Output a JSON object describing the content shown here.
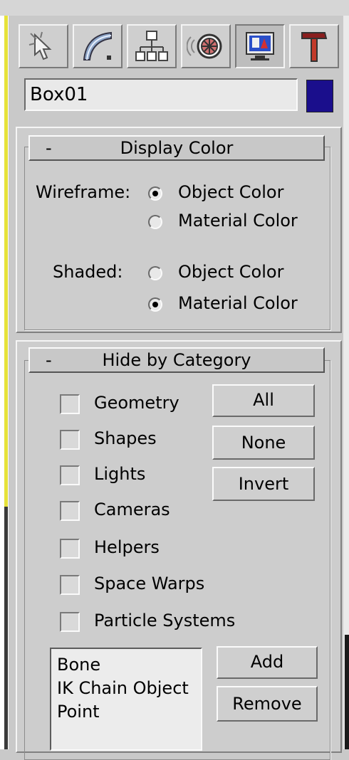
{
  "toolbar": {
    "tabs": [
      {
        "icon": "cursor-arrow-icon",
        "active": false
      },
      {
        "icon": "curve-modify-icon",
        "active": false
      },
      {
        "icon": "hierarchy-icon",
        "active": false
      },
      {
        "icon": "motion-wheel-icon",
        "active": false
      },
      {
        "icon": "display-monitor-icon",
        "active": true
      },
      {
        "icon": "hammer-utilities-icon",
        "active": false
      }
    ]
  },
  "object": {
    "name": "Box01",
    "color": "#1a0e8c"
  },
  "display_color": {
    "collapse_glyph": "-",
    "title": "Display Color",
    "wireframe": {
      "label": "Wireframe:",
      "options": [
        "Object Color",
        "Material Color"
      ],
      "selected": "Object Color"
    },
    "shaded": {
      "label": "Shaded:",
      "options": [
        "Object Color",
        "Material Color"
      ],
      "selected": "Material Color"
    }
  },
  "hide_by_category": {
    "collapse_glyph": "-",
    "title": "Hide by Category",
    "categories": [
      "Geometry",
      "Shapes",
      "Lights",
      "Cameras",
      "Helpers",
      "Space Warps",
      "Particle Systems"
    ],
    "buttons": {
      "all": "All",
      "none": "None",
      "invert": "Invert"
    },
    "list_items": [
      "Bone",
      "IK Chain Object",
      "Point"
    ],
    "add_label": "Add",
    "remove_label": "Remove"
  }
}
